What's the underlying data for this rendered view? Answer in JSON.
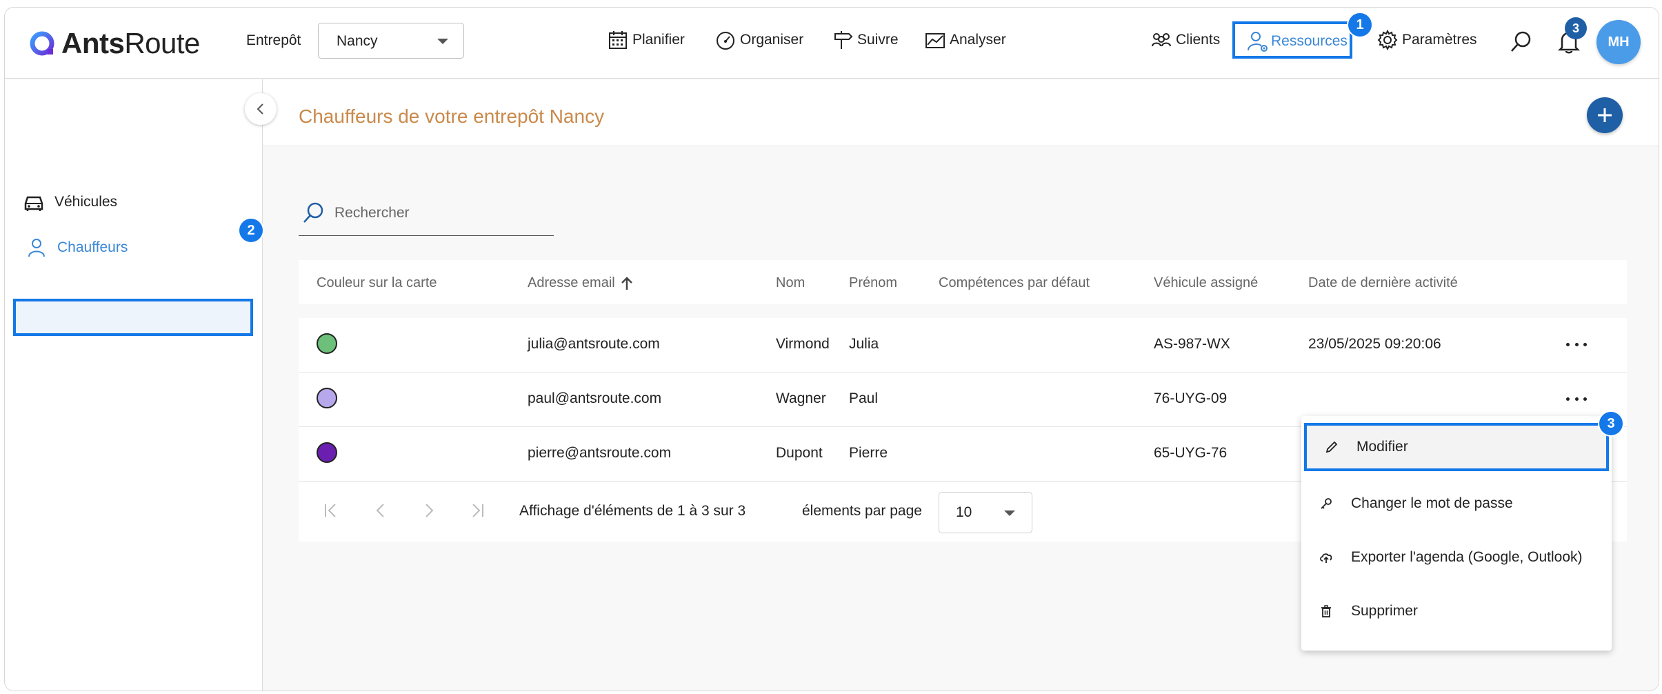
{
  "brand": {
    "name_bold": "Ants",
    "name_rest": "Route"
  },
  "header": {
    "entrepot_label": "Entrepôt",
    "entrepot_value": "Nancy",
    "nav": {
      "planifier": "Planifier",
      "organiser": "Organiser",
      "suivre": "Suivre",
      "analyser": "Analyser",
      "clients": "Clients",
      "ressources": "Ressources",
      "parametres": "Paramètres"
    },
    "notifications_count": "3",
    "avatar_initials": "MH"
  },
  "steps": {
    "one": "1",
    "two": "2",
    "three": "3"
  },
  "sidebar": {
    "items": [
      {
        "label": "Véhicules"
      },
      {
        "label": "Chauffeurs"
      }
    ]
  },
  "main": {
    "title": "Chauffeurs de votre entrepôt Nancy",
    "search_placeholder": "Rechercher",
    "columns": {
      "color": "Couleur sur la carte",
      "email": "Adresse email",
      "nom": "Nom",
      "prenom": "Prénom",
      "competences": "Compétences par défaut",
      "vehicule": "Véhicule assigné",
      "activite": "Date de dernière activité"
    },
    "rows": [
      {
        "color": "#6cc07a",
        "email": "julia@antsroute.com",
        "nom": "Virmond",
        "prenom": "Julia",
        "competences": "",
        "vehicule": "AS-987-WX",
        "activite": "23/05/2025 09:20:06"
      },
      {
        "color": "#b7a8ec",
        "email": "paul@antsroute.com",
        "nom": "Wagner",
        "prenom": "Paul",
        "competences": "",
        "vehicule": "76-UYG-09",
        "activite": ""
      },
      {
        "color": "#6a1fb0",
        "email": "pierre@antsroute.com",
        "nom": "Dupont",
        "prenom": "Pierre",
        "competences": "",
        "vehicule": "65-UYG-76",
        "activite": ""
      }
    ],
    "pager": {
      "summary": "Affichage d'éléments de 1 à 3 sur 3",
      "per_page_label": "élements par page",
      "per_page_value": "10"
    }
  },
  "context_menu": {
    "items": [
      {
        "label": "Modifier",
        "icon": "pencil-icon"
      },
      {
        "label": "Changer le mot de passe",
        "icon": "key-icon"
      },
      {
        "label": "Exporter l'agenda (Google, Outlook)",
        "icon": "cloud-upload-icon"
      },
      {
        "label": "Supprimer",
        "icon": "trash-icon"
      }
    ]
  },
  "colors": {
    "accent": "#1478e8",
    "brand_blue": "#1f5fa6",
    "title_orange": "#c98a4b"
  }
}
